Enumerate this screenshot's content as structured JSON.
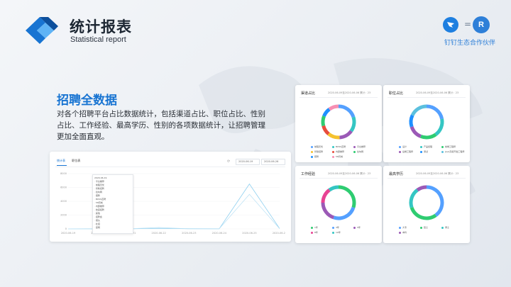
{
  "header": {
    "title": "统计报表",
    "subtitle": "Statistical report"
  },
  "partner": {
    "caption": "钉钉生态合作伙伴",
    "equals": "=",
    "mark": "R"
  },
  "section": {
    "title": "招聘全数据",
    "description": "对各个招聘平台占比数据统计，包括渠道占比、职位占比、性别占比、工作经验、最高学历、性别的各项数据统计，让招聘管理更加全面直观。"
  },
  "dashboard": {
    "tabs": [
      "统计表",
      "职位表"
    ],
    "date_start": "2020-06-19",
    "date_end": "2020-06-26",
    "refresh_icon": "refresh-icon",
    "tooltip_items": [
      "2020-06-19",
      "·  平台推荐",
      "·  前程无忧",
      "·  智联招聘",
      "·  拉勾网",
      "·  猎聘",
      "·  BOSS直聘",
      "·  58同城",
      "·  内部推荐",
      "·  校园招聘",
      "·  其他",
      "·  招聘会",
      "·  猎头",
      "·  社招",
      "·  官网"
    ],
    "chart_data": {
      "type": "line",
      "x": [
        "2020-06-19",
        "2020-06-20",
        "2020-06-21",
        "2020-06-22",
        "2020-06-23",
        "2020-06-24",
        "2020-06-25",
        "2020-06-26"
      ],
      "y_ticks": [
        "8000",
        "6000",
        "4000",
        "2000",
        "0"
      ],
      "series": [
        {
          "values": [
            10,
            20,
            15,
            80,
            30,
            20,
            6500,
            50
          ]
        },
        {
          "values": [
            5,
            10,
            5,
            200,
            10,
            10,
            5000,
            30
          ]
        }
      ]
    }
  },
  "cards": [
    {
      "title": "渠道占比",
      "date": "2020-06-09至2020-06-06   累计：23",
      "chart_data": {
        "type": "pie",
        "values": [
          20,
          15,
          14,
          12,
          10,
          10,
          9,
          10
        ]
      },
      "legend": [
        "前程无忧",
        "BOSS直聘",
        "平台推荐",
        "智联招聘",
        "内部推荐",
        "拉勾网",
        "猎聘",
        "58同城"
      ],
      "colors": [
        "#54a0ff",
        "#34c6c3",
        "#9b59b6",
        "#f5c22e",
        "#e74c3c",
        "#2ecc71",
        "#1e90ff",
        "#f78fb3"
      ]
    },
    {
      "title": "职位占比",
      "date": "2020-06-09至2020-06-06   累计：23",
      "chart_data": {
        "type": "pie",
        "values": [
          22,
          18,
          16,
          14,
          12,
          18
        ]
      },
      "legend": [
        "设计",
        "产品经理",
        "前端工程师",
        "后端工程师",
        "测试",
        "Java高级开发工程师"
      ],
      "colors": [
        "#54a0ff",
        "#34c6c3",
        "#2ecc71",
        "#9b59b6",
        "#1e90ff",
        "#5bc0de"
      ]
    },
    {
      "title": "工作经验",
      "date": "2020-06-09至2020-06-06   累计：23",
      "chart_data": {
        "type": "pie",
        "values": [
          30,
          25,
          20,
          15,
          10
        ]
      },
      "legend": [
        "1年",
        "3年",
        "5年",
        "8年",
        "10年"
      ],
      "colors": [
        "#2ecc71",
        "#54a0ff",
        "#9b59b6",
        "#e84393",
        "#34c6c3"
      ]
    },
    {
      "title": "最高学历",
      "date": "2020-06-09至2020-06-06   累计：23",
      "chart_data": {
        "type": "pie",
        "values": [
          40,
          30,
          20,
          10
        ]
      },
      "legend": [
        "大专",
        "硕士",
        "博士",
        "本科"
      ],
      "colors": [
        "#54a0ff",
        "#2ecc71",
        "#34c6c3",
        "#9b59b6"
      ]
    }
  ]
}
